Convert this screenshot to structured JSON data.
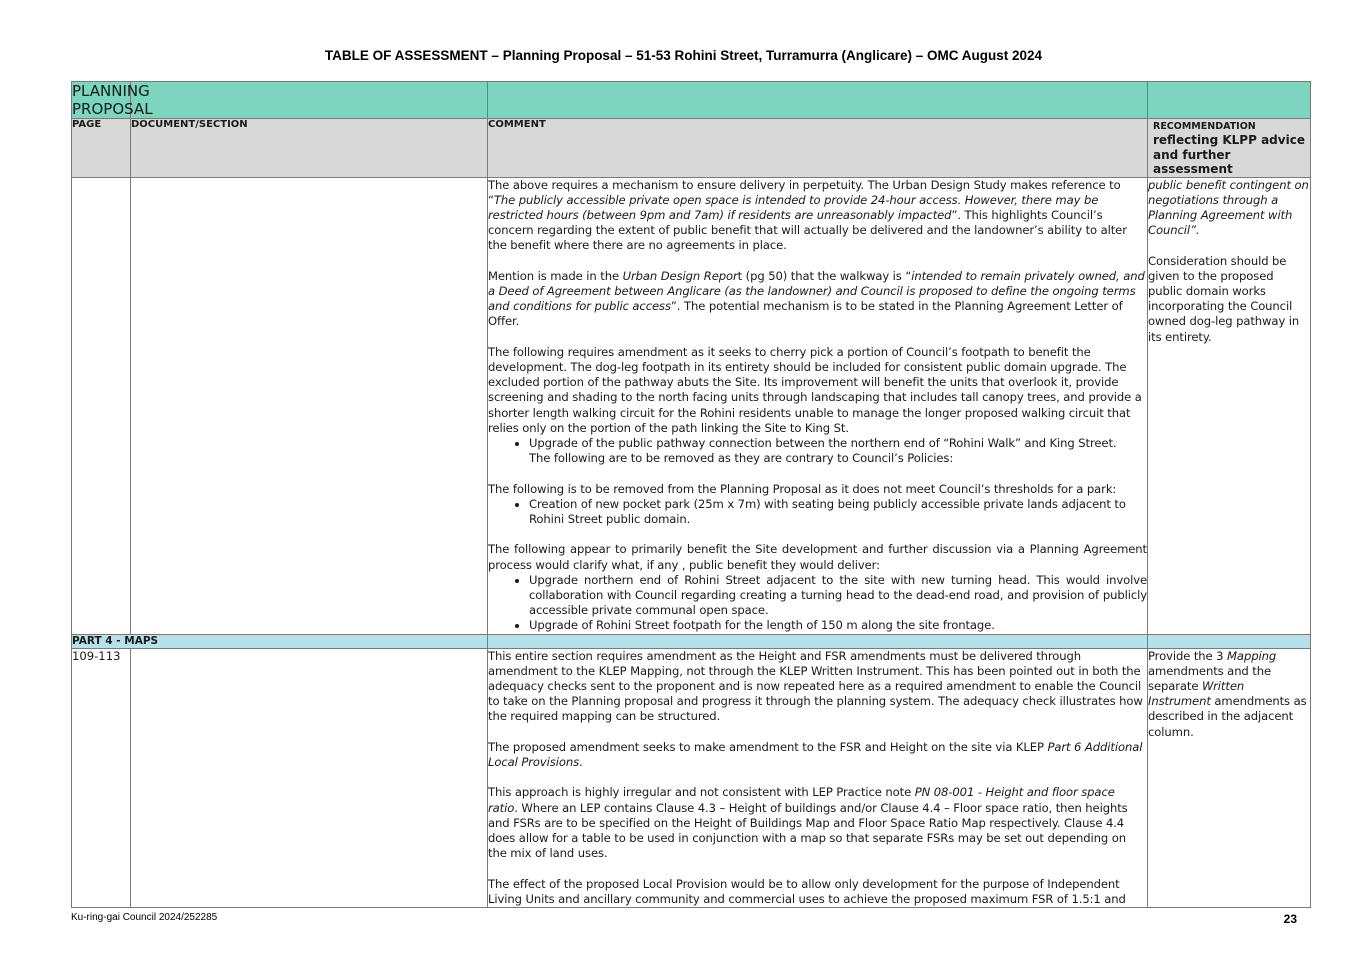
{
  "title": "TABLE OF ASSESSMENT – Planning Proposal – 51-53 Rohini Street, Turramurra (Anglicare) – OMC August 2024",
  "table": {
    "section_title": "PLANNING PROPOSAL",
    "headers": {
      "page": "PAGE",
      "document": "DOCUMENT/SECTION",
      "comment": "COMMENT",
      "rec_line1": "RECOMMENDATION",
      "rec_line2": "reflecting KLPP advice",
      "rec_line3": "and further assessment"
    },
    "row1": {
      "page": "",
      "document": "",
      "p1": {
        "a": "The above requires a mechanism to ensure delivery in perpetuity. The Urban Design Study makes reference to “",
        "b": "The publicly accessible private open space is intended to provide 24-hour access. However, there may be restricted hours (between 9pm and 7am) if residents are unreasonably impacted",
        "c": "”. This highlights Council’s concern regarding the extent of public benefit that will actually be delivered and the landowner’s ability to alter the benefit where there are no agreements in place."
      },
      "p2": {
        "a": "Mention is made in the ",
        "b": "Urban Design Repor",
        "c": "t (pg 50) that the walkway is “",
        "d": "intended to remain privately owned, and a Deed of Agreement between Anglicare (as the landowner) and Council is proposed to define the ongoing terms and conditions for public access",
        "e": "”. The potential mechanism is to be stated in the Planning Agreement Letter of Offer."
      },
      "p3": "The following requires amendment as it seeks to cherry pick a portion of Council’s footpath to benefit the development. The dog-leg footpath in its entirety should be included for consistent public domain upgrade. The excluded portion of the pathway abuts the Site. Its improvement will benefit the units that overlook it, provide screening and shading to the north facing units through landscaping that includes tall canopy trees, and provide a shorter length walking circuit for the Rohini residents unable to manage the longer proposed walking circuit that relies only on the portion of the path linking the Site to King St.",
      "p3_bullet": "Upgrade of the public pathway connection between the northern end of “Rohini Walk” and King Street.",
      "p3_after": "The following are to be removed as they are contrary to Council’s Policies:",
      "p4": "The following is to be removed from the Planning Proposal as it does not meet Council’s thresholds for a park:",
      "p4_bullet": "Creation of new pocket park (25m x 7m) with seating being publicly accessible private lands adjacent to Rohini Street public domain.",
      "p5": "The following appear to primarily benefit the Site development and further discussion via a Planning Agreement process would clarify what, if any , public benefit they would deliver:",
      "p5_bullet1": "Upgrade northern end of Rohini Street adjacent to the site with new turning head. This would involve collaboration with Council regarding creating a turning head to the dead-end road, and provision of publicly accessible private communal open space.",
      "p5_bullet2": "Upgrade of Rohini Street footpath for the length of 150 m along the site frontage.",
      "rec1": "public benefit contingent on negotiations through a Planning Agreement with Council”.",
      "rec2": "Consideration should be given to the proposed public domain works incorporating the Council owned dog-leg pathway in its entirety."
    },
    "part4": {
      "title": "PART 4 - MAPS",
      "page": "109-113",
      "document": "",
      "p1": "This entire section requires amendment as the Height and FSR amendments must be delivered through amendment to the KLEP Mapping, not through the KLEP Written Instrument. This has been pointed out in both the adequacy checks sent to the proponent and is now repeated here as a required amendment to enable the Council to take on the Planning proposal and progress it through the planning system. The adequacy check illustrates how the required mapping can be structured.",
      "p2": {
        "a": "The proposed amendment seeks to make amendment to the FSR and Height on the site via KLEP ",
        "b": "Part 6 Additional Local Provisions",
        "c": "."
      },
      "p3": {
        "a": "This approach is highly irregular and not consistent with LEP Practice note ",
        "b": "PN 08-001 - Height and floor space ratio",
        "c": ". Where an LEP contains Clause 4.3 – Height of buildings and/or Clause 4.4 – Floor space ratio, then heights and FSRs are to be specified on the Height of Buildings Map and Floor Space Ratio Map respectively. Clause 4.4 does allow for a table to be used in conjunction with a map so that separate FSRs may be set out depending on the mix of land uses."
      },
      "p4": "The effect of the proposed Local Provision would be to allow only development for the purpose of Independent Living Units and ancillary community and commercial uses to achieve the proposed maximum FSR of 1.5:1 and",
      "rec": {
        "a": "Provide the 3 ",
        "b": "Mapping",
        "c": " amendments and the separate ",
        "d": "Written Instrument",
        "e": " amendments as described in the adjacent column."
      }
    }
  },
  "footer": {
    "doc_ref": "Ku-ring-gai Council 2024/252285",
    "page_number": "23"
  }
}
